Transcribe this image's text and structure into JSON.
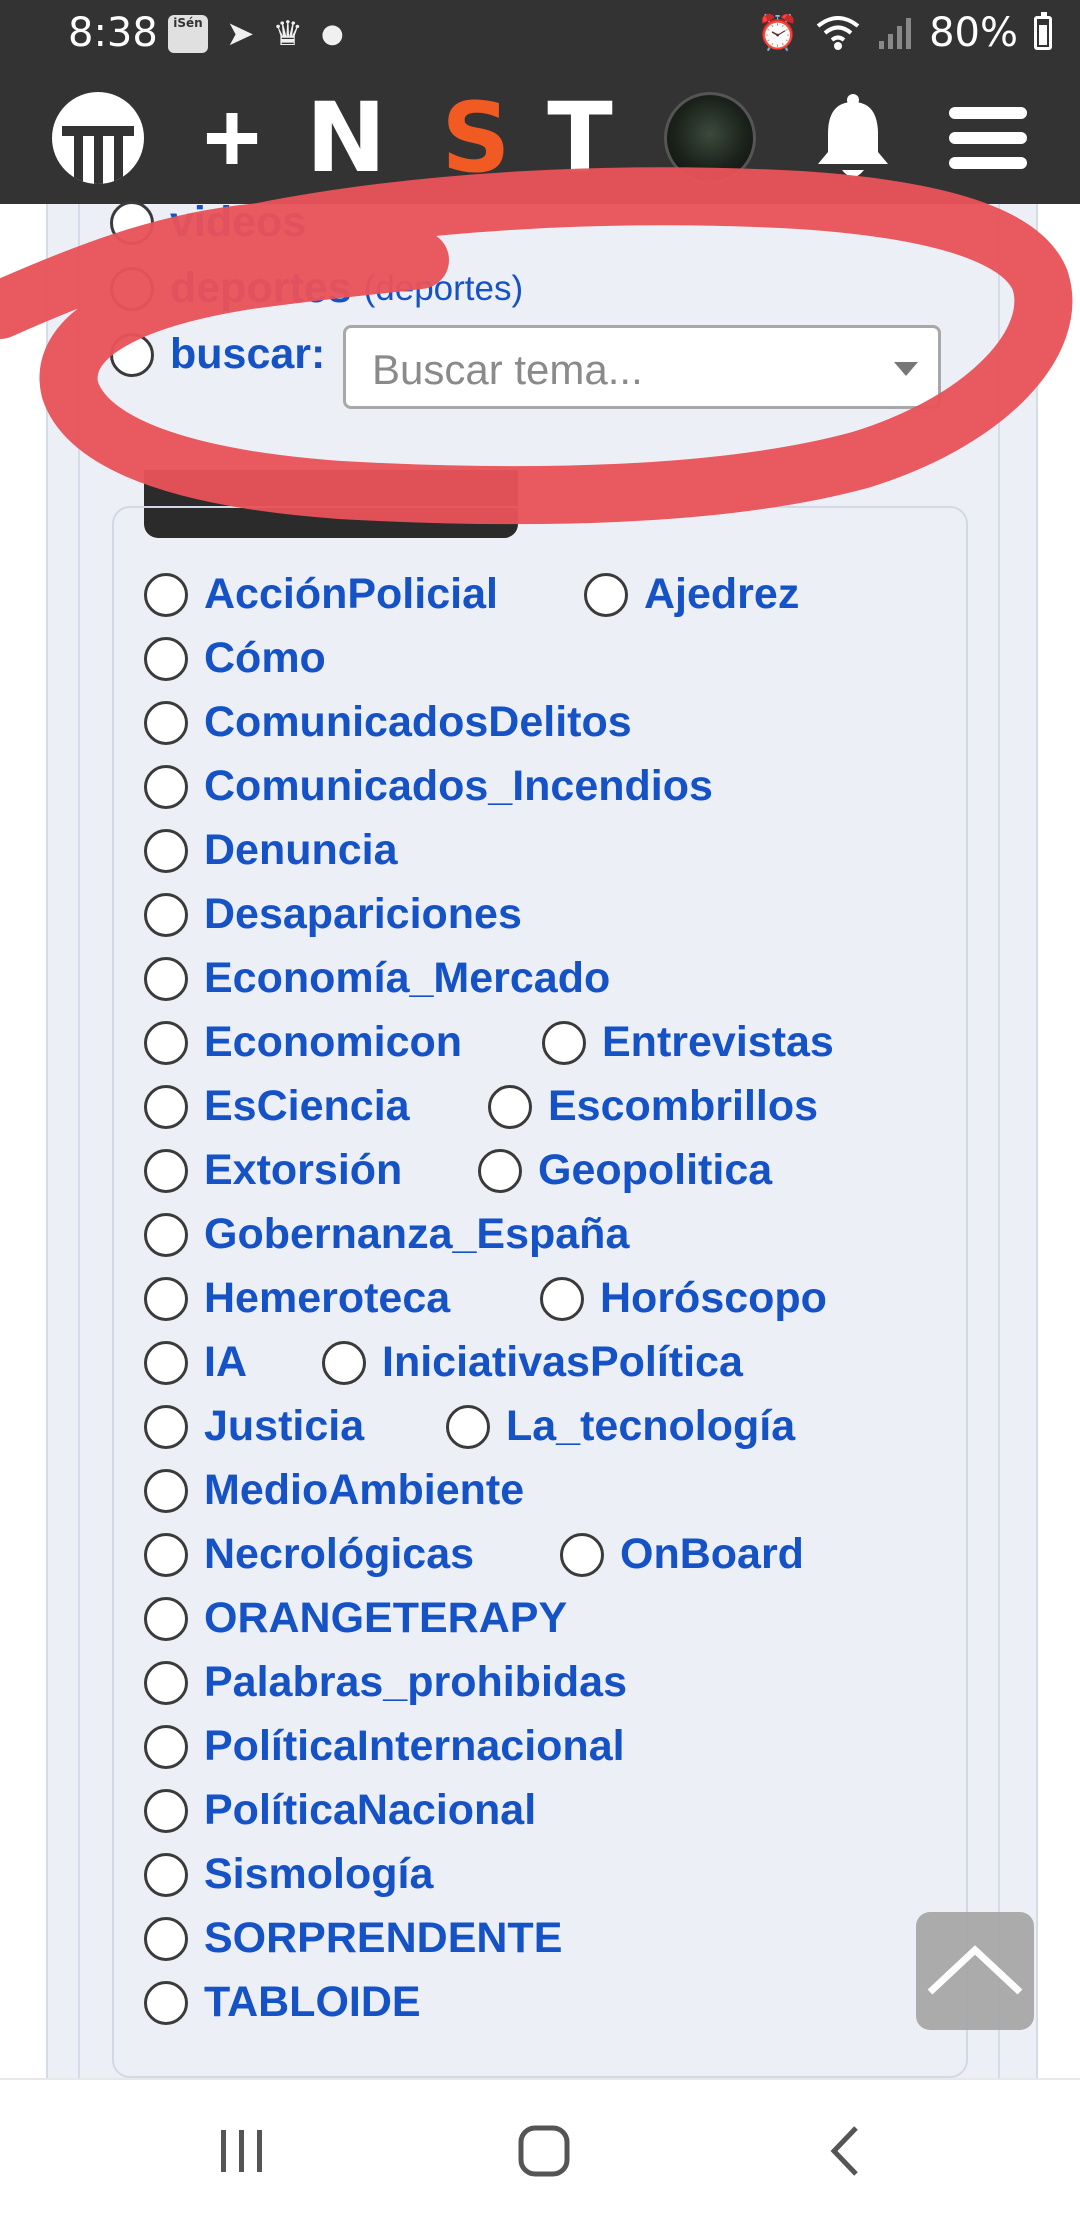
{
  "status_bar": {
    "time": "8:38",
    "app_badge": "iSén",
    "battery": "80%"
  },
  "nav": {
    "letters": [
      "N",
      "S",
      "T"
    ],
    "accent_color": "#f15a22"
  },
  "top_options": {
    "videos": "videos",
    "deportes": "deportes",
    "deportes_sub": "(deportes)",
    "buscar": "buscar:",
    "search_placeholder": "Buscar tema..."
  },
  "categories": [
    "AcciónPolicial",
    "Ajedrez",
    "Cómo",
    "ComunicadosDelitos",
    "Comunicados_Incendios",
    "Denuncia",
    "Desapariciones",
    "Economía_Mercado",
    "Economicon",
    "Entrevistas",
    "EsCiencia",
    "Escombrillos",
    "Extorsión",
    "Geopolitica",
    "Gobernanza_España",
    "Hemeroteca",
    "Horóscopo",
    "IA",
    "IniciativasPolítica",
    "Justicia",
    "La_tecnología",
    "MedioAmbiente",
    "Necrológicas",
    "OnBoard",
    "ORANGETERAPY",
    "Palabras_prohibidas",
    "PolíticaInternacional",
    "PolíticaNacional",
    "Sismología",
    "SORPRENDENTE",
    "TABLOIDE"
  ],
  "colors": {
    "link": "#1552c6",
    "header_bg": "#333333",
    "panel_bg": "#eceff6",
    "annotation": "#e8525a"
  }
}
